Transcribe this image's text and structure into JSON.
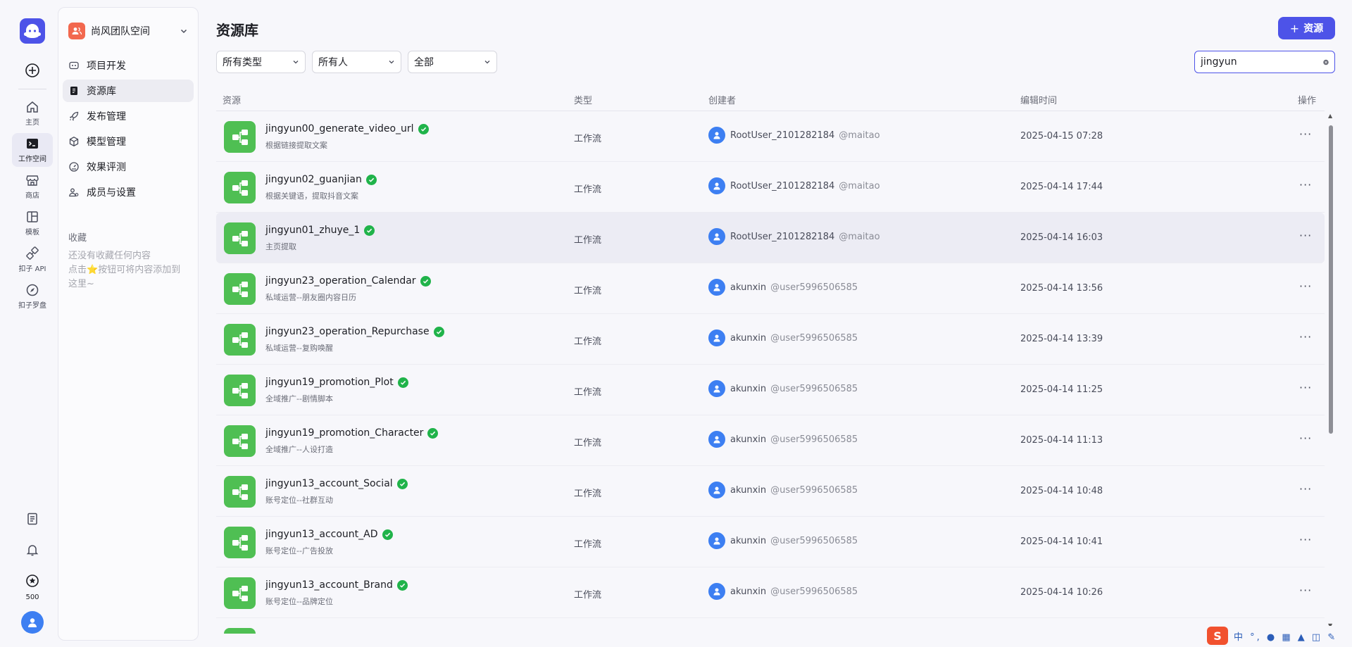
{
  "rail": {
    "items": [
      {
        "label": "主页",
        "icon": "home-icon"
      },
      {
        "label": "工作空间",
        "icon": "terminal-icon"
      },
      {
        "label": "商店",
        "icon": "store-icon"
      },
      {
        "label": "模板",
        "icon": "template-icon"
      },
      {
        "label": "扣子 API",
        "icon": "api-icon"
      },
      {
        "label": "扣子罗盘",
        "icon": "compass-icon"
      }
    ],
    "points": "500"
  },
  "sidebar": {
    "team_name": "尚风团队空间",
    "nav": [
      {
        "label": "项目开发",
        "icon": "project-icon"
      },
      {
        "label": "资源库",
        "icon": "library-icon"
      },
      {
        "label": "发布管理",
        "icon": "rocket-icon"
      },
      {
        "label": "模型管理",
        "icon": "cube-icon"
      },
      {
        "label": "效果评测",
        "icon": "gauge-icon"
      },
      {
        "label": "成员与设置",
        "icon": "members-icon"
      }
    ],
    "favorites_title": "收藏",
    "favorites_empty_1": "还没有收藏任何内容",
    "favorites_empty_2a": "点击",
    "favorites_empty_2b": "按钮可将内容添加到",
    "favorites_empty_3": "这里~"
  },
  "main": {
    "title": "资源库",
    "add_button": "资源",
    "filters": [
      "所有类型",
      "所有人",
      "全部"
    ],
    "search_value": "jingyun"
  },
  "table": {
    "headers": {
      "resource": "资源",
      "type": "类型",
      "creator": "创建者",
      "time": "编辑时间",
      "actions": "操作"
    },
    "rows": [
      {
        "name": "jingyun00_generate_video_url",
        "desc": "根据链接提取文案",
        "type": "工作流",
        "creator": "RootUser_2101282184",
        "handle": "@maitao",
        "time": "2025-04-15 07:28"
      },
      {
        "name": "jingyun02_guanjian",
        "desc": "根据关键语，提取抖音文案",
        "type": "工作流",
        "creator": "RootUser_2101282184",
        "handle": "@maitao",
        "time": "2025-04-14 17:44"
      },
      {
        "name": "jingyun01_zhuye_1",
        "desc": "主页提取",
        "type": "工作流",
        "creator": "RootUser_2101282184",
        "handle": "@maitao",
        "time": "2025-04-14 16:03"
      },
      {
        "name": "jingyun23_operation_Calendar",
        "desc": "私域运营--朋友圈内容日历",
        "type": "工作流",
        "creator": "akunxin",
        "handle": "@user5996506585",
        "time": "2025-04-14 13:56"
      },
      {
        "name": "jingyun23_operation_Repurchase",
        "desc": "私域运营--复购唤醒",
        "type": "工作流",
        "creator": "akunxin",
        "handle": "@user5996506585",
        "time": "2025-04-14 13:39"
      },
      {
        "name": "jingyun19_promotion_Plot",
        "desc": "全域推广--剧情脚本",
        "type": "工作流",
        "creator": "akunxin",
        "handle": "@user5996506585",
        "time": "2025-04-14 11:25"
      },
      {
        "name": "jingyun19_promotion_Character",
        "desc": "全域推广--人设打造",
        "type": "工作流",
        "creator": "akunxin",
        "handle": "@user5996506585",
        "time": "2025-04-14 11:13"
      },
      {
        "name": "jingyun13_account_Social",
        "desc": "账号定位--社群互动",
        "type": "工作流",
        "creator": "akunxin",
        "handle": "@user5996506585",
        "time": "2025-04-14 10:48"
      },
      {
        "name": "jingyun13_account_AD",
        "desc": "账号定位--广告投放",
        "type": "工作流",
        "creator": "akunxin",
        "handle": "@user5996506585",
        "time": "2025-04-14 10:41"
      },
      {
        "name": "jingyun13_account_Brand",
        "desc": "账号定位--品牌定位",
        "type": "工作流",
        "creator": "akunxin",
        "handle": "@user5996506585",
        "time": "2025-04-14 10:26"
      }
    ]
  },
  "ime": {
    "logo": "S",
    "text": "中 °, ● ▦ ▲ ◫ ✎"
  },
  "colors": {
    "accent": "#4d53e8",
    "workflow": "#4fbf53",
    "verified": "#20b34a",
    "team": "#f2684e"
  }
}
